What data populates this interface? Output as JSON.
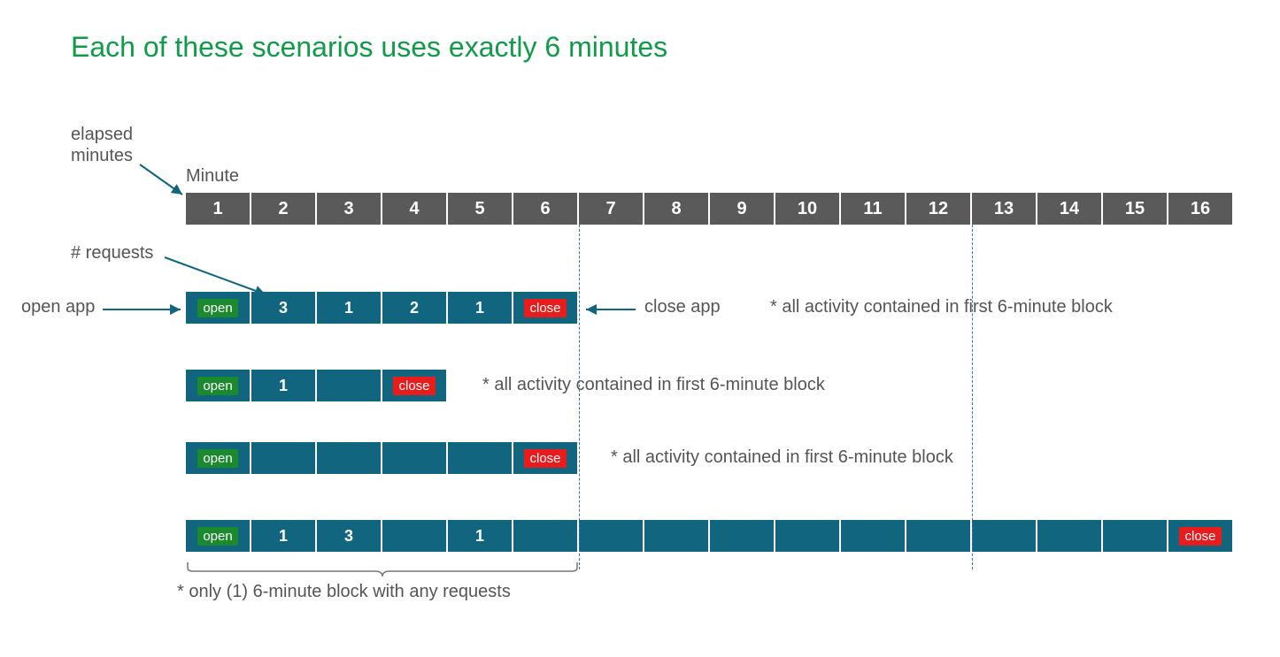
{
  "title": "Each of these scenarios uses exactly 6 minutes",
  "labels": {
    "elapsed_minutes": "elapsed\nminutes",
    "minute": "Minute",
    "requests": "# requests",
    "open_app": "open app",
    "close_app": "close app"
  },
  "open_text": "open",
  "close_text": "close",
  "header_minutes": [
    "1",
    "2",
    "3",
    "4",
    "5",
    "6",
    "7",
    "8",
    "9",
    "10",
    "11",
    "12",
    "13",
    "14",
    "15",
    "16"
  ],
  "scenarios": [
    {
      "cells": [
        {
          "type": "open"
        },
        {
          "type": "val",
          "v": "3"
        },
        {
          "type": "val",
          "v": "1"
        },
        {
          "type": "val",
          "v": "2"
        },
        {
          "type": "val",
          "v": "1"
        },
        {
          "type": "close"
        }
      ],
      "note": "* all activity contained in first 6-minute block"
    },
    {
      "cells": [
        {
          "type": "open"
        },
        {
          "type": "val",
          "v": "1"
        },
        {
          "type": "empty"
        },
        {
          "type": "close"
        }
      ],
      "note": "* all activity contained in first 6-minute block"
    },
    {
      "cells": [
        {
          "type": "open"
        },
        {
          "type": "empty"
        },
        {
          "type": "empty"
        },
        {
          "type": "empty"
        },
        {
          "type": "empty"
        },
        {
          "type": "close"
        }
      ],
      "note": "* all activity contained in first 6-minute block"
    },
    {
      "cells": [
        {
          "type": "open"
        },
        {
          "type": "val",
          "v": "1"
        },
        {
          "type": "val",
          "v": "3"
        },
        {
          "type": "empty"
        },
        {
          "type": "val",
          "v": "1"
        },
        {
          "type": "empty"
        },
        {
          "type": "empty"
        },
        {
          "type": "empty"
        },
        {
          "type": "empty"
        },
        {
          "type": "empty"
        },
        {
          "type": "empty"
        },
        {
          "type": "empty"
        },
        {
          "type": "empty"
        },
        {
          "type": "empty"
        },
        {
          "type": "empty"
        },
        {
          "type": "close"
        }
      ],
      "note": "* only (1) 6-minute block with any requests"
    }
  ]
}
